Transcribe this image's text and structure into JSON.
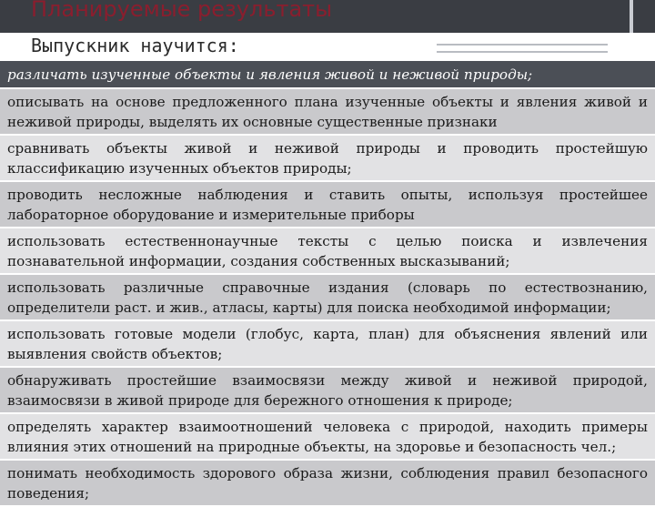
{
  "slide": {
    "title": "Планируемые результаты",
    "subtitle": "Выпускник научится:"
  },
  "table": {
    "header": "различать изученные объекты и явления живой и неживой природы;",
    "rows": [
      "описывать на основе предложенного плана изученные объекты и явления живой и неживой природы, выделять их основные существенные признаки",
      "сравнивать объекты живой и неживой природы и проводить простейшую классификацию изученных объектов природы;",
      "проводить несложные наблюдения и ставить опыты, используя простейшее лабораторное оборудование и измерительные приборы",
      "использовать естественнонаучные тексты с целью поиска и извлечения познавательной информации, создания собственных высказываний;",
      "использовать различные справочные издания (словарь по естествознанию, определители раст. и жив., атласы, карты) для поиска необходимой информации;",
      "использовать готовые модели (глобус, карта, план) для объяснения явлений или выявления свойств объектов;",
      "обнаруживать простейшие взаимосвязи между живой и неживой природой, взаимосвязи в живой природе для бережного отношения к природе;",
      "определять характер взаимоотношений человека с природой, находить примеры влияния этих отношений на природные объекты, на здоровье и безопасность чел.;",
      "понимать необходимость здорового образа жизни, соблюдения правил безопасного поведения;"
    ]
  }
}
